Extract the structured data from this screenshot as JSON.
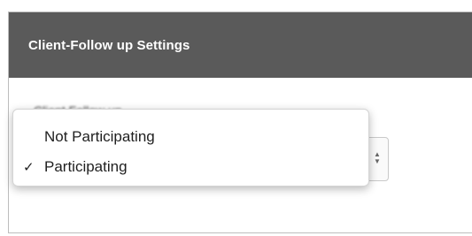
{
  "panel": {
    "title": "Client-Follow up Settings"
  },
  "field": {
    "label": "Client Follow up",
    "selected_value": "Participating"
  },
  "dropdown": {
    "options": [
      {
        "label": "Not Participating",
        "checked": false,
        "check_glyph": ""
      },
      {
        "label": "Participating",
        "checked": true,
        "check_glyph": "✓"
      }
    ]
  },
  "icons": {
    "checkmark": "checkmark-icon",
    "select_arrows": "up-down-chevron-icon"
  },
  "colors": {
    "header_background": "#5a5a5a",
    "header_text": "#ffffff"
  }
}
